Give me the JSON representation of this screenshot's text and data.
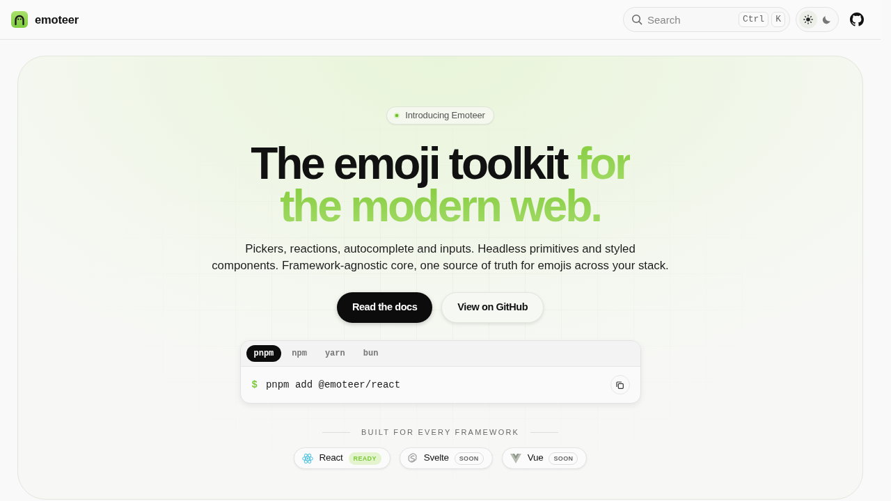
{
  "header": {
    "brand": "emoteer",
    "search": {
      "placeholder": "Search",
      "shortcut": [
        "Ctrl",
        "K"
      ]
    },
    "theme_toggle": [
      {
        "kind": "light",
        "selected": true
      },
      {
        "kind": "dark",
        "selected": false
      }
    ]
  },
  "hero": {
    "badge": "Introducing Emoteer",
    "headline": [
      {
        "text": "The emoji toolkit",
        "accent": false
      },
      {
        "text": "for the modern web.",
        "accent": true
      }
    ],
    "description": "Pickers, reactions, autocomplete and inputs. Headless primitives and styled components. Framework-agnostic core, one source of truth for emojis across your stack.",
    "actions": [
      {
        "label": "Read the docs",
        "kind": "primary"
      },
      {
        "label": "View on GitHub",
        "kind": "secondary"
      }
    ],
    "install": {
      "tabs": [
        {
          "label": "pnpm",
          "selected": true
        },
        {
          "label": "npm",
          "selected": false
        },
        {
          "label": "yarn",
          "selected": false
        },
        {
          "label": "bun",
          "selected": false
        }
      ],
      "prompt": "$",
      "command": "pnpm add @emoteer/react"
    },
    "frameworks": {
      "title": "BUILT FOR EVERY FRAMEWORK",
      "items": [
        {
          "name": "React",
          "status": "READY",
          "ready": true
        },
        {
          "name": "Svelte",
          "status": "SOON",
          "ready": false
        },
        {
          "name": "Vue",
          "status": "SOON",
          "ready": false
        }
      ]
    }
  }
}
